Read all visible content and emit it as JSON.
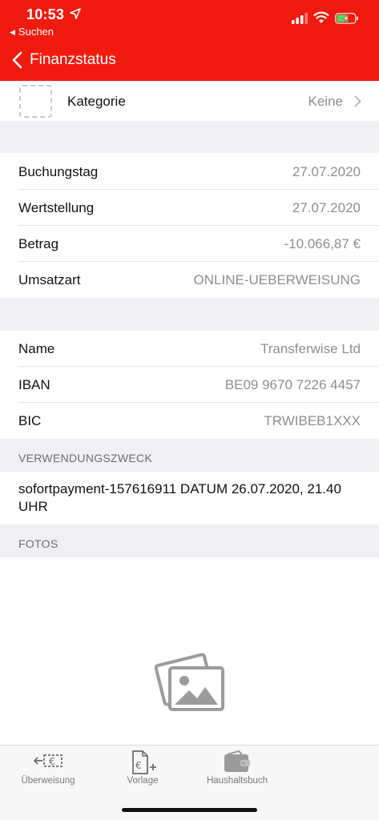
{
  "status_bar": {
    "time": "10:53",
    "back_app": "Suchen"
  },
  "header": {
    "title": "Finanzstatus"
  },
  "category": {
    "label": "Kategorie",
    "value": "Keine"
  },
  "booking_details": [
    {
      "label": "Buchungstag",
      "value": "27.07.2020"
    },
    {
      "label": "Wertstellung",
      "value": "27.07.2020"
    },
    {
      "label": "Betrag",
      "value": "-10.066,87 €"
    },
    {
      "label": "Umsatzart",
      "value": "ONLINE-UEBERWEISUNG"
    }
  ],
  "counterparty": [
    {
      "label": "Name",
      "value": "Transferwise Ltd"
    },
    {
      "label": "IBAN",
      "value": "BE09 9670 7226 4457"
    },
    {
      "label": "BIC",
      "value": "TRWIBEB1XXX"
    }
  ],
  "purpose": {
    "header": "VERWENDUNGSZWECK",
    "text": "sofortpayment-157616911 DATUM 26.07.2020, 21.40 UHR"
  },
  "photos": {
    "header": "FOTOS"
  },
  "tabbar": {
    "items": [
      {
        "label": "Überweisung",
        "icon": "transfer-icon"
      },
      {
        "label": "Vorlage",
        "icon": "template-icon"
      },
      {
        "label": "Haushaltsbuch",
        "icon": "wallet-icon"
      }
    ]
  },
  "colors": {
    "brand_red": "#f11a0f",
    "group_background": "#efeff4",
    "secondary_text": "#8e8e93"
  }
}
